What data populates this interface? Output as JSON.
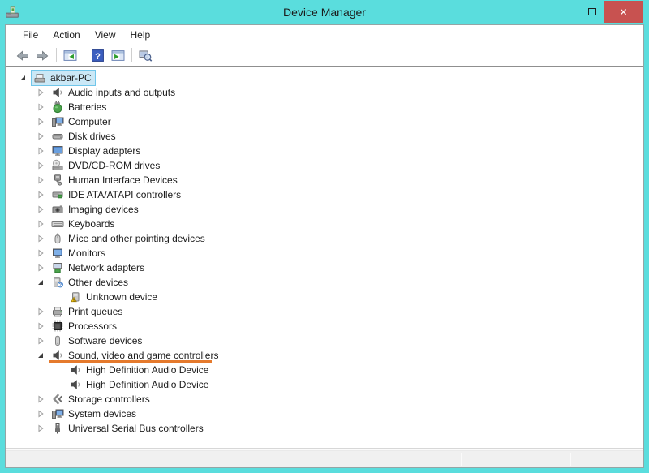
{
  "window": {
    "title": "Device Manager",
    "icon": "device-manager-icon",
    "accent_color": "#5adddd",
    "close_color": "#c85250",
    "controls": [
      {
        "name": "minimize-button"
      },
      {
        "name": "maximize-button"
      },
      {
        "name": "close-button"
      }
    ]
  },
  "menu": {
    "items": [
      "File",
      "Action",
      "View",
      "Help"
    ]
  },
  "toolbar": {
    "buttons": [
      {
        "type": "button",
        "name": "back",
        "icon": "arrow-left-icon"
      },
      {
        "type": "button",
        "name": "forward",
        "icon": "arrow-right-icon"
      },
      {
        "type": "separator"
      },
      {
        "type": "button",
        "name": "show-hide-console-tree",
        "icon": "console-tree-icon"
      },
      {
        "type": "separator"
      },
      {
        "type": "button",
        "name": "help",
        "icon": "help-icon"
      },
      {
        "type": "button",
        "name": "show-hide-action-pane",
        "icon": "action-pane-icon"
      },
      {
        "type": "separator"
      },
      {
        "type": "button",
        "name": "scan-for-hardware-changes",
        "icon": "scan-hardware-icon"
      }
    ]
  },
  "tree": {
    "selection_bg": "#cbe8f6",
    "selection_border": "#70c6ea",
    "underline_color": "#e57a2d",
    "rows": [
      {
        "label": "akbar-PC",
        "icon": "computer-pc-icon",
        "level": 0,
        "expander": "expanded",
        "selected": true
      },
      {
        "label": "Audio inputs and outputs",
        "icon": "speaker-icon",
        "level": 1,
        "expander": "collapsed"
      },
      {
        "label": "Batteries",
        "icon": "battery-icon",
        "level": 1,
        "expander": "collapsed"
      },
      {
        "label": "Computer",
        "icon": "computer-icon",
        "level": 1,
        "expander": "collapsed"
      },
      {
        "label": "Disk drives",
        "icon": "disk-drive-icon",
        "level": 1,
        "expander": "collapsed"
      },
      {
        "label": "Display adapters",
        "icon": "display-adapter-icon",
        "level": 1,
        "expander": "collapsed"
      },
      {
        "label": "DVD/CD-ROM drives",
        "icon": "dvd-drive-icon",
        "level": 1,
        "expander": "collapsed"
      },
      {
        "label": "Human Interface Devices",
        "icon": "hid-icon",
        "level": 1,
        "expander": "collapsed"
      },
      {
        "label": "IDE ATA/ATAPI controllers",
        "icon": "ide-controller-icon",
        "level": 1,
        "expander": "collapsed"
      },
      {
        "label": "Imaging devices",
        "icon": "imaging-device-icon",
        "level": 1,
        "expander": "collapsed"
      },
      {
        "label": "Keyboards",
        "icon": "keyboard-icon",
        "level": 1,
        "expander": "collapsed"
      },
      {
        "label": "Mice and other pointing devices",
        "icon": "mouse-icon",
        "level": 1,
        "expander": "collapsed"
      },
      {
        "label": "Monitors",
        "icon": "monitor-icon",
        "level": 1,
        "expander": "collapsed"
      },
      {
        "label": "Network adapters",
        "icon": "network-adapter-icon",
        "level": 1,
        "expander": "collapsed"
      },
      {
        "label": "Other devices",
        "icon": "other-device-icon",
        "level": 1,
        "expander": "expanded"
      },
      {
        "label": "Unknown device",
        "icon": "unknown-device-warning-icon",
        "level": 2,
        "expander": "none"
      },
      {
        "label": "Print queues",
        "icon": "printer-icon",
        "level": 1,
        "expander": "collapsed"
      },
      {
        "label": "Processors",
        "icon": "processor-icon",
        "level": 1,
        "expander": "collapsed"
      },
      {
        "label": "Software devices",
        "icon": "software-device-icon",
        "level": 1,
        "expander": "collapsed"
      },
      {
        "label": "Sound, video and game controllers",
        "icon": "speaker-icon",
        "level": 1,
        "expander": "expanded",
        "underlined": true
      },
      {
        "label": "High Definition Audio Device",
        "icon": "speaker-icon",
        "level": 2,
        "expander": "none"
      },
      {
        "label": "High Definition Audio Device",
        "icon": "speaker-icon",
        "level": 2,
        "expander": "none"
      },
      {
        "label": "Storage controllers",
        "icon": "storage-controller-icon",
        "level": 1,
        "expander": "collapsed"
      },
      {
        "label": "System devices",
        "icon": "system-device-icon",
        "level": 1,
        "expander": "collapsed"
      },
      {
        "label": "Universal Serial Bus controllers",
        "icon": "usb-controller-icon",
        "level": 1,
        "expander": "collapsed"
      }
    ]
  },
  "statusbar": {
    "text": ""
  }
}
